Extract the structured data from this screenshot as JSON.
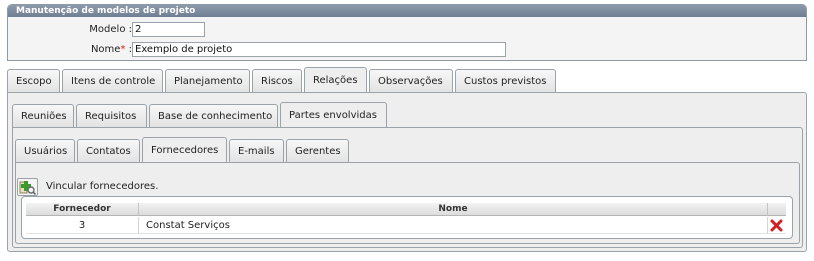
{
  "panel": {
    "title": "Manutenção de modelos de projeto"
  },
  "form": {
    "modelo_label": "Modelo :",
    "modelo_value": "2",
    "nome_label": "Nome",
    "nome_required": "*",
    "nome_colon": ":",
    "nome_value": "Exemplo de projeto"
  },
  "main_tabs": {
    "items": [
      "Escopo",
      "Itens de controle",
      "Planejamento",
      "Riscos",
      "Relações",
      "Observações",
      "Custos previstos"
    ],
    "active": "Relações"
  },
  "sub_tabs": {
    "items": [
      "Reuniões",
      "Requisitos",
      "Base de conhecimento",
      "Partes envolvidas"
    ],
    "active": "Partes envolvidas"
  },
  "inner_tabs": {
    "items": [
      "Usuários",
      "Contatos",
      "Fornecedores",
      "E-mails",
      "Gerentes"
    ],
    "active": "Fornecedores"
  },
  "action": {
    "add_label": "Vincular fornecedores.",
    "add_icon": "add-link-icon"
  },
  "table": {
    "columns": [
      "Fornecedor",
      "Nome"
    ],
    "rows": [
      {
        "fornecedor": "3",
        "nome": "Constat Serviços"
      }
    ],
    "row_action_icon": "delete-icon"
  },
  "colors": {
    "header": "#7a889a",
    "delete": "#d21f1f",
    "add": "#3a9b2a"
  }
}
